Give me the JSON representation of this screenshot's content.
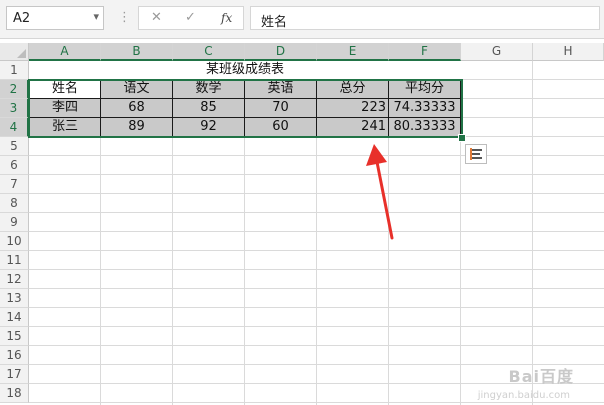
{
  "formula_bar": {
    "name_box": "A2",
    "separator": "⋮",
    "cancel_icon": "✕",
    "enter_icon": "✓",
    "fx_label": "fx",
    "formula_value": "姓名"
  },
  "columns": [
    "A",
    "B",
    "C",
    "D",
    "E",
    "F",
    "G",
    "H"
  ],
  "rows": [
    "1",
    "2",
    "3",
    "4",
    "5",
    "6",
    "7",
    "8",
    "9",
    "10",
    "11",
    "12",
    "13",
    "14",
    "15",
    "16",
    "17",
    "18"
  ],
  "sheet": {
    "title": "某班级成绩表",
    "headers": [
      "姓名",
      "语文",
      "数学",
      "英语",
      "总分",
      "平均分"
    ],
    "data": [
      [
        "李四",
        "68",
        "85",
        "70",
        "223",
        "74.33333"
      ],
      [
        "张三",
        "89",
        "92",
        "60",
        "241",
        "80.33333"
      ]
    ]
  },
  "watermark": {
    "main": "Bai百度",
    "sub": "jingyan.baidu.com"
  },
  "colors": {
    "selection": "#217346",
    "cell_fill": "#c9c9c9",
    "arrow": "#e8302a"
  }
}
